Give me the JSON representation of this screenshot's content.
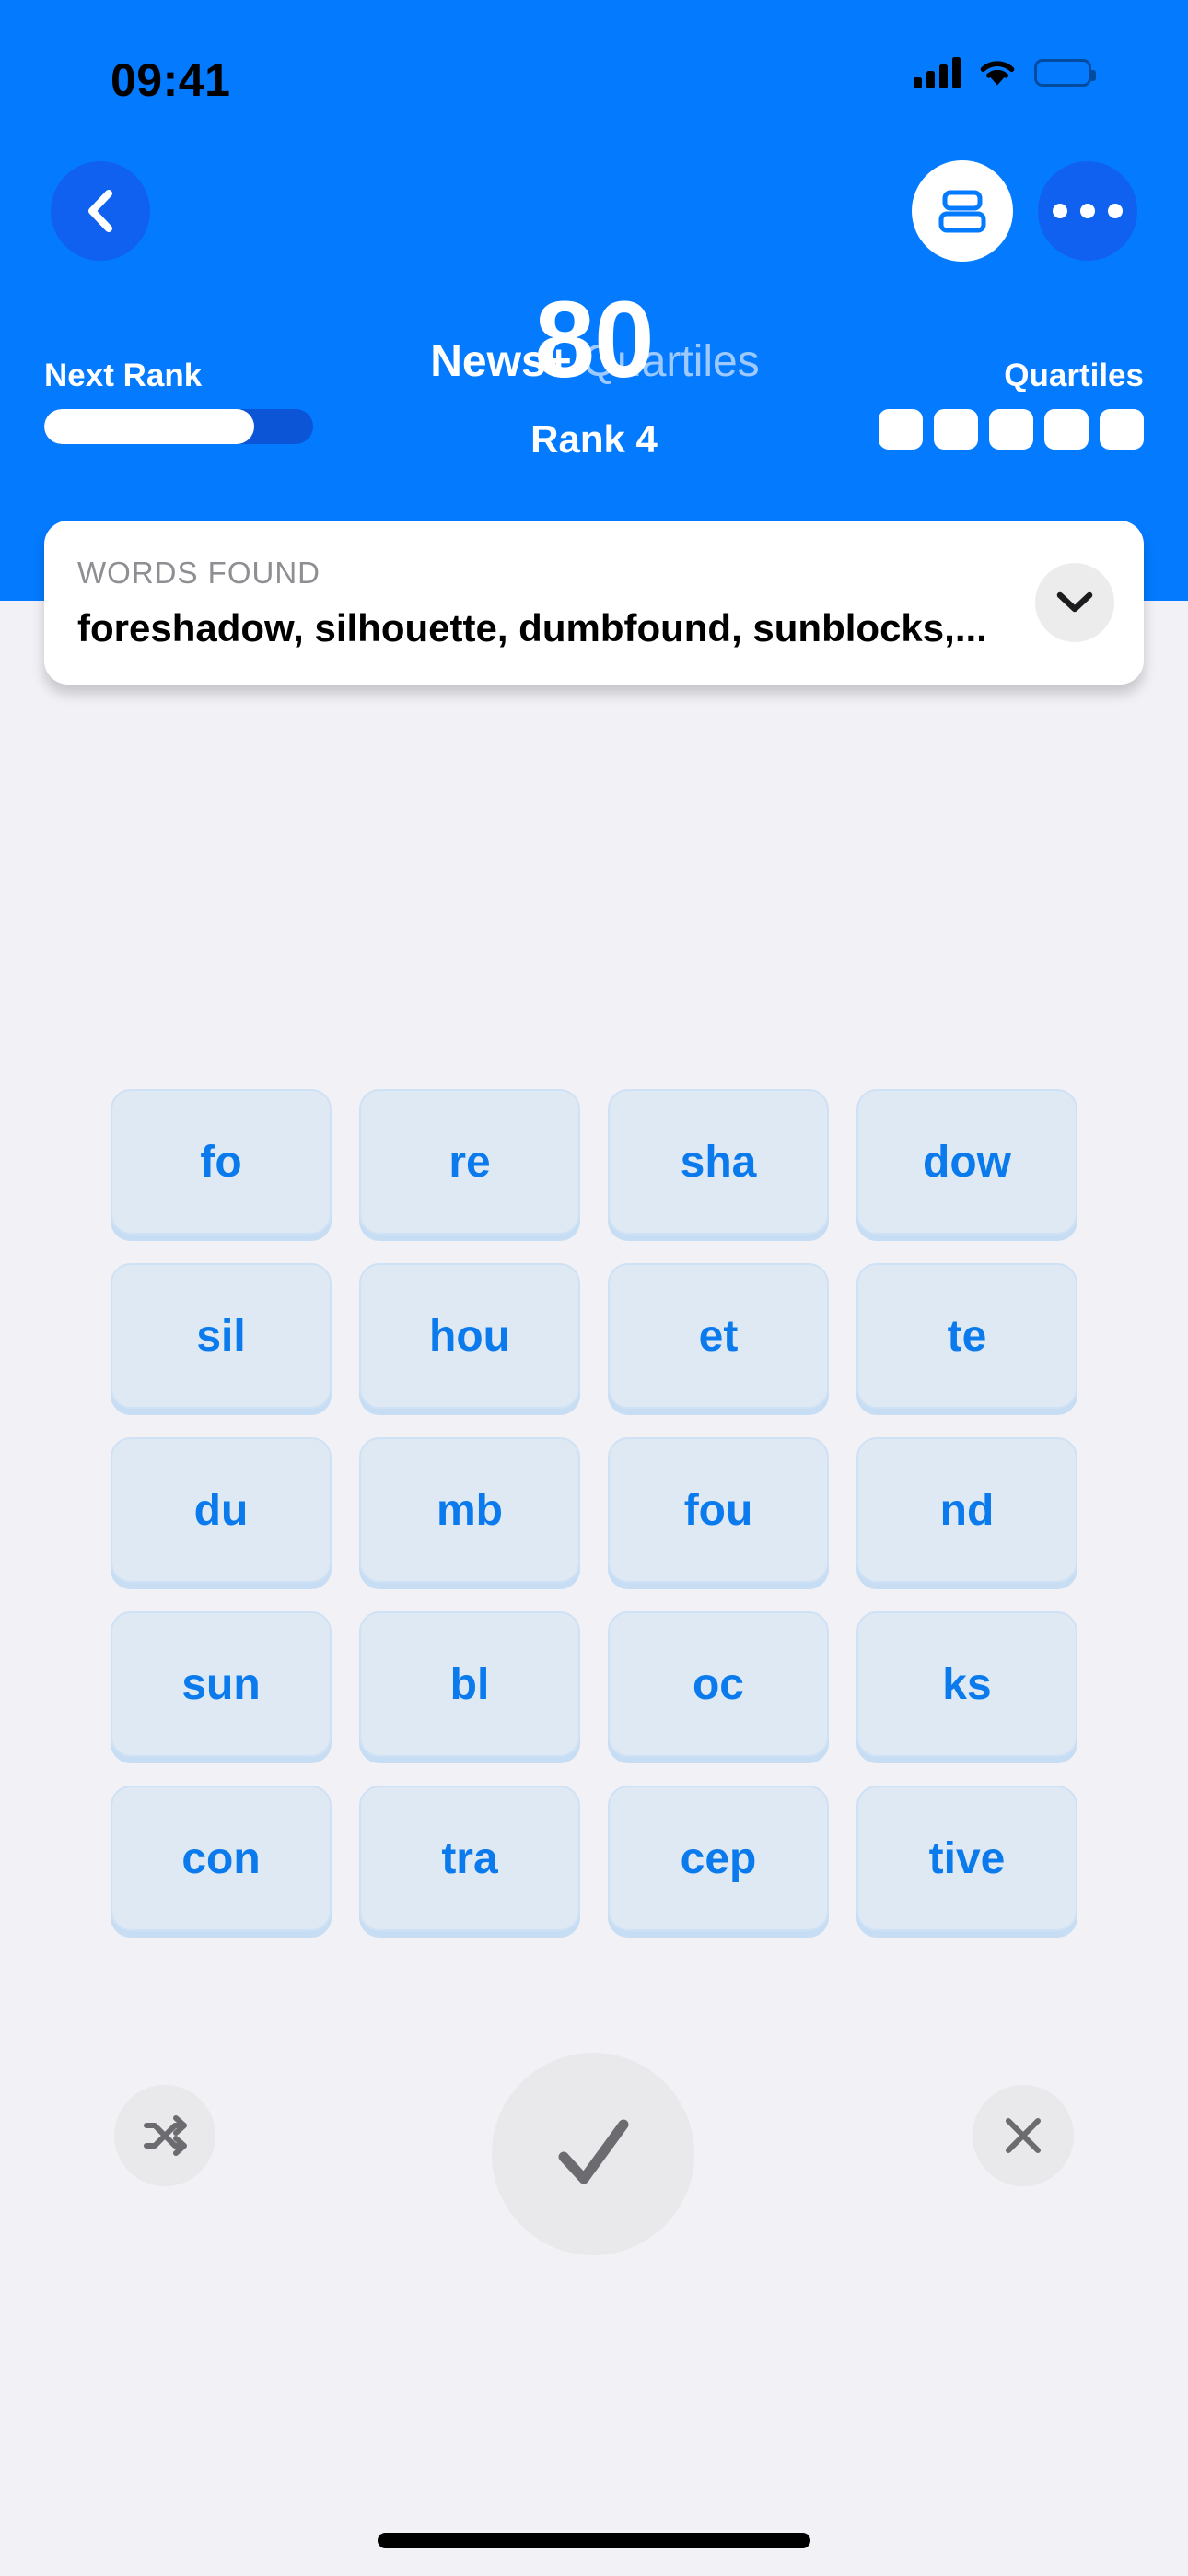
{
  "status_bar": {
    "time": "09:41",
    "cellular_icon": "cellular-signal-icon",
    "wifi_icon": "wifi-icon",
    "battery_icon": "battery-icon"
  },
  "nav": {
    "back_icon": "chevron-left-icon",
    "layout_icon": "stacked-rows-icon",
    "more_icon": "ellipsis-icon",
    "title_apple_glyph": "",
    "title_primary": "News+",
    "title_secondary": "Quartiles"
  },
  "score": {
    "value": "80",
    "rank_label": "Rank 4",
    "next_rank_label": "Next Rank",
    "next_rank_progress_percent": 78,
    "quartiles_label": "Quartiles",
    "quartiles_boxes": 5
  },
  "words_found": {
    "heading": "WORDS FOUND",
    "words_preview": "foreshadow, silhouette, dumbfound, sunblocks,...",
    "expand_icon": "chevron-down-icon"
  },
  "grid": {
    "rows": [
      [
        "fo",
        "re",
        "sha",
        "dow"
      ],
      [
        "sil",
        "hou",
        "et",
        "te"
      ],
      [
        "du",
        "mb",
        "fou",
        "nd"
      ],
      [
        "sun",
        "bl",
        "oc",
        "ks"
      ],
      [
        "con",
        "tra",
        "cep",
        "tive"
      ]
    ]
  },
  "actions": {
    "shuffle_icon": "shuffle-icon",
    "submit_icon": "checkmark-icon",
    "clear_icon": "close-x-icon"
  },
  "colors": {
    "header_blue": "#047aff",
    "dark_blue_button": "#1061ef",
    "progress_track": "#0b55d6",
    "background": "#f1f1f6",
    "tile_fill": "#dfe9f4",
    "tile_shadow": "#c7ddf3",
    "tile_text": "#0a7aec",
    "title_secondary": "#9dc9ff",
    "muted_text": "#8e8e93",
    "action_button": "#e9e9ec",
    "action_icon": "#6c6c70"
  }
}
